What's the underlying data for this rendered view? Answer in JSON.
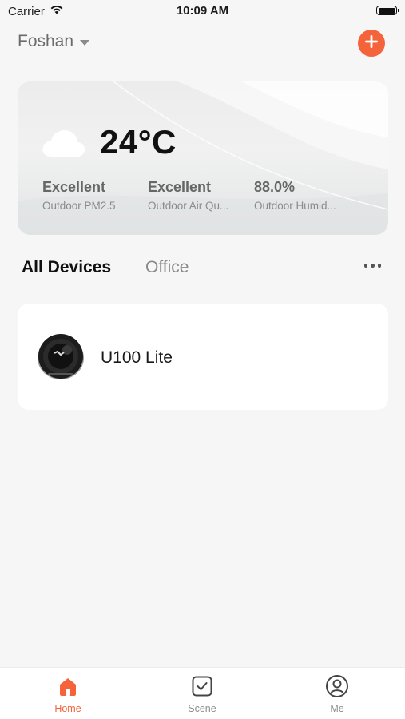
{
  "status_bar": {
    "carrier": "Carrier",
    "time": "10:09 AM",
    "wifi_icon": "wifi-icon",
    "battery_icon": "battery-icon"
  },
  "header": {
    "location": "Foshan",
    "caret_icon": "caret-down-icon",
    "add_icon": "plus-icon"
  },
  "weather": {
    "icon": "cloud-icon",
    "temperature": "24°C",
    "metrics": [
      {
        "value": "Excellent",
        "label": "Outdoor PM2.5"
      },
      {
        "value": "Excellent",
        "label": "Outdoor Air Qu..."
      },
      {
        "value": "88.0%",
        "label": "Outdoor Humid..."
      }
    ]
  },
  "tabs": {
    "items": [
      "All Devices",
      "Office"
    ],
    "active": "All Devices",
    "more_icon": "more-horizontal-icon"
  },
  "devices": [
    {
      "name": "U100 Lite",
      "icon": "robot-vacuum-icon"
    }
  ],
  "tabbar": {
    "items": [
      {
        "label": "Home",
        "icon": "home-icon",
        "active": true
      },
      {
        "label": "Scene",
        "icon": "scene-check-icon",
        "active": false
      },
      {
        "label": "Me",
        "icon": "user-icon",
        "active": false
      }
    ]
  },
  "colors": {
    "accent": "#f4633a",
    "background": "#f6f6f6",
    "card": "#ffffff"
  }
}
